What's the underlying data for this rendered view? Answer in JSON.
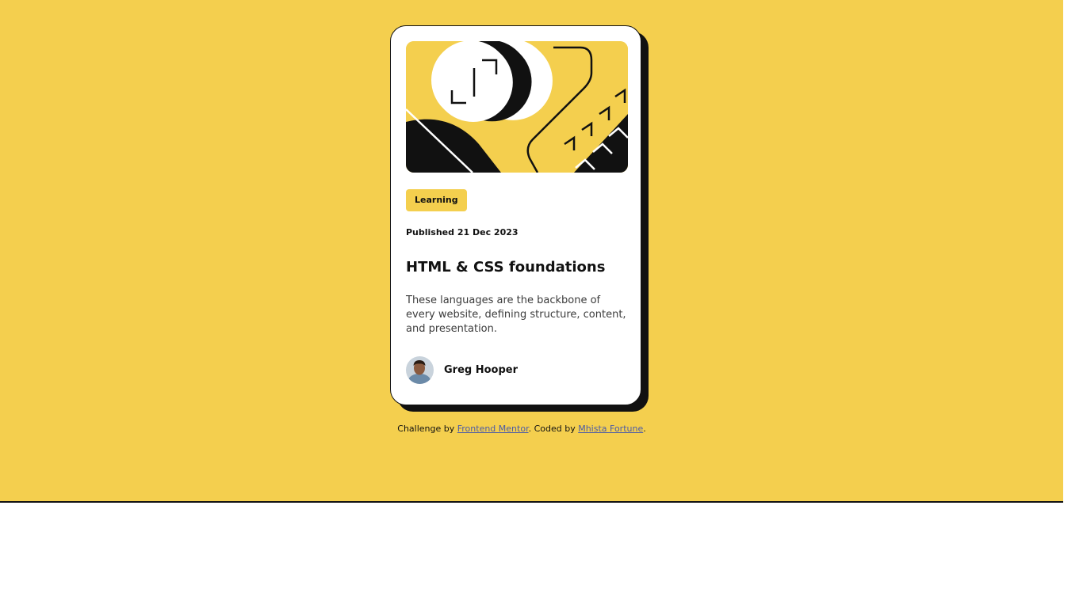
{
  "card": {
    "hero_image": "illustration-article",
    "category": "Learning",
    "published": "Published 21 Dec 2023",
    "title": "HTML & CSS foundations",
    "description": "These languages are the backbone of every website, defining structure, content, and presentation.",
    "author": {
      "name": "Greg Hooper",
      "avatar": "avatar-photo"
    }
  },
  "footer": {
    "challenge_prefix": "Challenge by ",
    "challenge_link": "Frontend Mentor",
    "coded_prefix": ". Coded by ",
    "coded_link": "Mhista Fortune",
    "suffix": "."
  },
  "colors": {
    "background": "#F4CF4E",
    "card": "#FFFFFF",
    "ink": "#111111",
    "link": "#4B5BA6"
  }
}
